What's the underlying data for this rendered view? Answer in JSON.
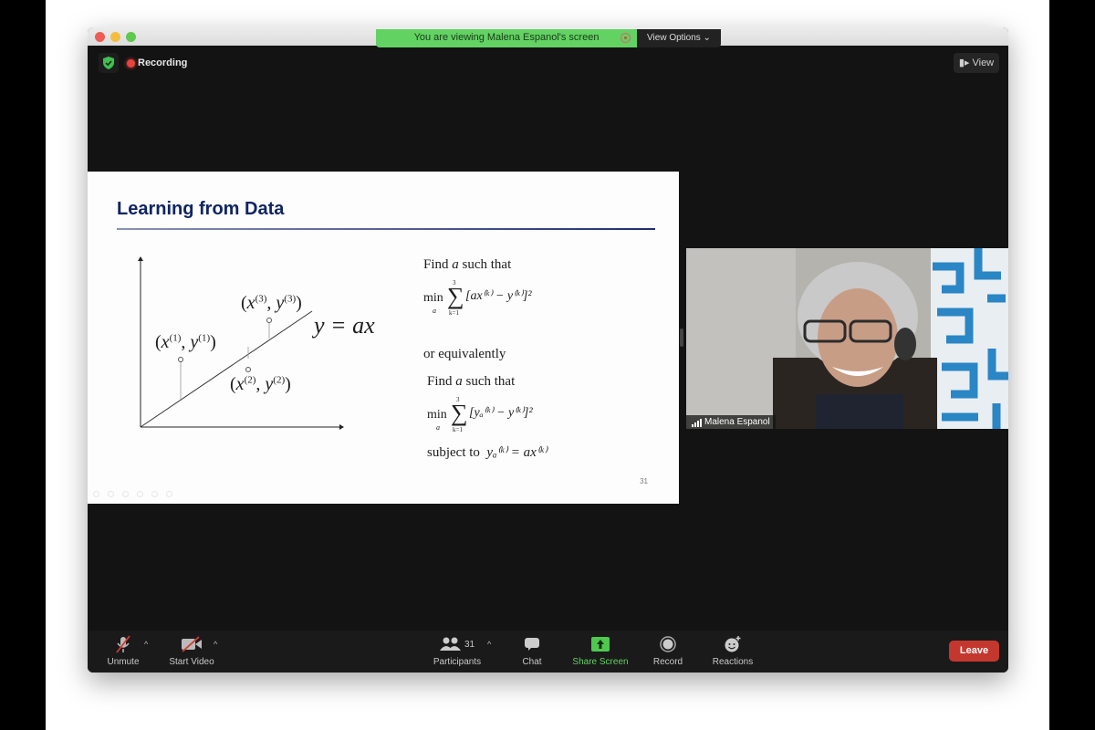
{
  "window": {
    "share_banner": "You are viewing Malena Espanol's screen",
    "view_options": "View Options ⌄",
    "recording": "Recording",
    "view_button": "View"
  },
  "slide": {
    "title": "Learning from Data",
    "page_number": "31",
    "diagram": {
      "line_label": "y = ax",
      "points": [
        {
          "label_x": "x",
          "sup": "(1)",
          "label_y": "y"
        },
        {
          "label_x": "x",
          "sup": "(2)",
          "label_y": "y"
        },
        {
          "label_x": "x",
          "sup": "(3)",
          "label_y": "y"
        }
      ]
    },
    "text": {
      "find1_pre": "Find ",
      "find1_var": "a",
      "find1_post": " such that",
      "min": "min",
      "min_sub": "a",
      "sum_top": "3",
      "sum_bottom": "k=1",
      "expr1": "[ax⁽ᵏ⁾ − y⁽ᵏ⁾]²",
      "or_equiv": "or equivalently",
      "find2_pre": "Find ",
      "find2_var": "a",
      "find2_post": " such that",
      "expr2": "[yₐ⁽ᵏ⁾ − y⁽ᵏ⁾]²",
      "subject_to": "subject to",
      "constraint": "yₐ⁽ᵏ⁾ = ax⁽ᵏ⁾"
    }
  },
  "video": {
    "participant_name": "Malena Espanol"
  },
  "toolbar": {
    "unmute": "Unmute",
    "start_video": "Start Video",
    "participants": "Participants",
    "participant_count": "31",
    "chat": "Chat",
    "share_screen": "Share Screen",
    "record": "Record",
    "reactions": "Reactions",
    "leave": "Leave"
  },
  "colors": {
    "share_green": "#62d262",
    "leave_red": "#c4372f",
    "slide_title": "#0f2463"
  }
}
